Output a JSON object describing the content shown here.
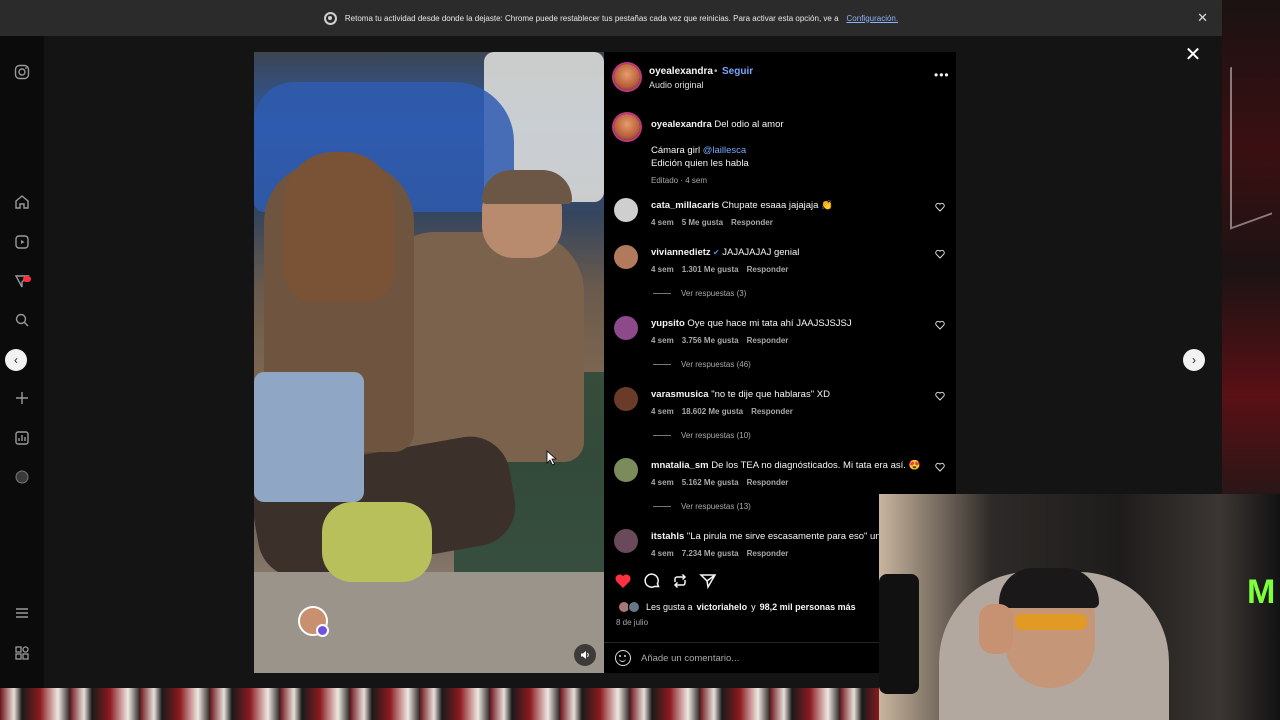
{
  "browser_notice": {
    "text": "Retoma tu actividad desde donde la dejaste: Chrome puede restablecer tus pestañas cada vez que reinicias. Para activar esta opción, ve a",
    "link": "Configuración."
  },
  "post": {
    "username": "oyealexandra",
    "separator": "•",
    "follow_label": "Seguir",
    "audio_label": "Audio original",
    "caption": {
      "username": "oyealexandra",
      "line1": "Del odio al amor",
      "line2_prefix": "Cámara girl",
      "line2_mention": "@laillesca",
      "line3": "Edición quien les habla",
      "meta": "Editado · 4 sem"
    },
    "likes_prefix": "Les gusta a",
    "likes_user": "victoriahelo",
    "likes_suffix": "y",
    "likes_count": "98,2 mil personas más",
    "date": "8 de julio",
    "add_comment_placeholder": "Añade un comentario..."
  },
  "comments": [
    {
      "user": "cata_millacaris",
      "text": "Chupate esaaa jajajaja 👏",
      "time": "4 sem",
      "likes": "5 Me gusta",
      "reply": "Responder",
      "replies": ""
    },
    {
      "user": "viviannedietz",
      "verified": true,
      "text": "JAJAJAJAJ genial",
      "time": "4 sem",
      "likes": "1.301 Me gusta",
      "reply": "Responder",
      "replies": "Ver respuestas (3)"
    },
    {
      "user": "yupsito",
      "text": "Oye que hace mi tata ahí JAAJSJSJSJ",
      "time": "4 sem",
      "likes": "3.756 Me gusta",
      "reply": "Responder",
      "replies": "Ver respuestas (46)"
    },
    {
      "user": "varasmusica",
      "text": "\"no te dije que hablaras\" XD",
      "time": "4 sem",
      "likes": "18.602 Me gusta",
      "reply": "Responder",
      "replies": "Ver respuestas (10)"
    },
    {
      "user": "mnatalia_sm",
      "text": "De los TEA no diagnósticados. Mi tata era así. 😍",
      "time": "4 sem",
      "likes": "5.162 Me gusta",
      "reply": "Responder",
      "replies": "Ver respuestas (13)"
    },
    {
      "user": "itstahls",
      "text": "\"La pirula me sirve escasamente para eso\" un",
      "time": "4 sem",
      "likes": "7.234 Me gusta",
      "reply": "Responder",
      "replies": ""
    }
  ],
  "icons": {
    "sidebar": [
      "instagram-icon",
      "home-icon",
      "reels-icon",
      "messages-icon",
      "search-icon",
      "create-icon",
      "insights-icon",
      "profile-icon",
      "menu-icon",
      "more-apps-icon"
    ],
    "actions": [
      "heart-icon",
      "comment-icon",
      "repost-icon",
      "share-icon"
    ]
  },
  "colors": {
    "accent": "#7aa7ff",
    "like": "#ff3040",
    "panel": "#000000"
  }
}
